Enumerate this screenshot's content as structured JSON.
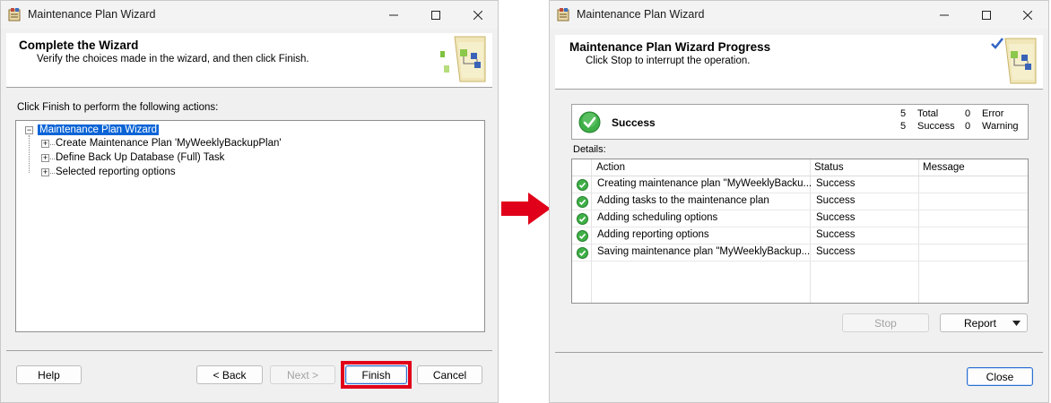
{
  "window1": {
    "title": "Maintenance Plan Wizard",
    "header": {
      "title": "Complete the Wizard",
      "subtitle": "Verify the choices made in the wizard, and then click Finish."
    },
    "intro": "Click Finish to perform the following actions:",
    "tree": {
      "root": "Maintenance Plan Wizard",
      "children": [
        "Create Maintenance Plan 'MyWeeklyBackupPlan'",
        "Define Back Up Database (Full) Task",
        "Selected reporting options"
      ]
    },
    "buttons": {
      "help": "Help",
      "back": "< Back",
      "next": "Next >",
      "finish": "Finish",
      "cancel": "Cancel"
    },
    "highlight_color": "#e1001a"
  },
  "window2": {
    "title": "Maintenance Plan Wizard",
    "header": {
      "title": "Maintenance Plan Wizard Progress",
      "subtitle": "Click Stop to interrupt the operation."
    },
    "summary": {
      "status": "Success",
      "total_count": "5",
      "total_label": "Total",
      "success_count": "5",
      "success_label": "Success",
      "error_count": "0",
      "error_label": "Error",
      "warning_count": "0",
      "warning_label": "Warning"
    },
    "details_label": "Details:",
    "columns": [
      "Action",
      "Status",
      "Message"
    ],
    "rows": [
      {
        "action": "Creating maintenance plan \"MyWeeklyBacku...",
        "status": "Success",
        "message": ""
      },
      {
        "action": "Adding tasks to the maintenance plan",
        "status": "Success",
        "message": ""
      },
      {
        "action": "Adding scheduling options",
        "status": "Success",
        "message": ""
      },
      {
        "action": "Adding reporting options",
        "status": "Success",
        "message": ""
      },
      {
        "action": "Saving maintenance plan \"MyWeeklyBackup...",
        "status": "Success",
        "message": ""
      }
    ],
    "buttons": {
      "stop": "Stop",
      "report": "Report",
      "close": "Close"
    },
    "success_color": "#2e9e35"
  },
  "icons": {
    "app": "maintenance-wizard-icon",
    "minimize": "minimize-icon",
    "maximize": "maximize-icon",
    "close": "close-icon",
    "arrow": "right-arrow-icon",
    "success": "check-circle-icon"
  }
}
